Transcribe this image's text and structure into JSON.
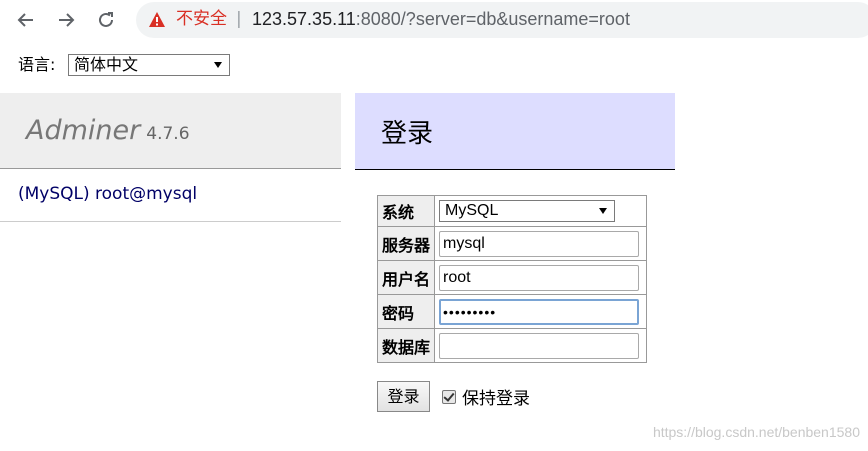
{
  "browser": {
    "security_label": "不安全",
    "separator": "|",
    "url_host": "123.57.35.11",
    "url_rest": ":8080/?server=db&username=root"
  },
  "language": {
    "label": "语言:",
    "selected": "简体中文"
  },
  "menu": {
    "brand": "Adminer",
    "version": "4.7.6",
    "db_link": "(MySQL) root@mysql"
  },
  "content": {
    "title": "登录"
  },
  "form": {
    "system_label": "系统",
    "system_value": "MySQL",
    "server_label": "服务器",
    "server_value": "mysql",
    "username_label": "用户名",
    "username_value": "root",
    "password_label": "密码",
    "password_value": "•••••••••",
    "database_label": "数据库",
    "database_value": "",
    "submit_label": "登录",
    "remember_label": "保持登录",
    "remember_checked": true
  },
  "watermark": "https://blog.csdn.net/benben1580",
  "colors": {
    "warning": "#d93025",
    "menu_bg": "#eeeeee",
    "header_bg": "#ddddff",
    "link": "#000066"
  }
}
